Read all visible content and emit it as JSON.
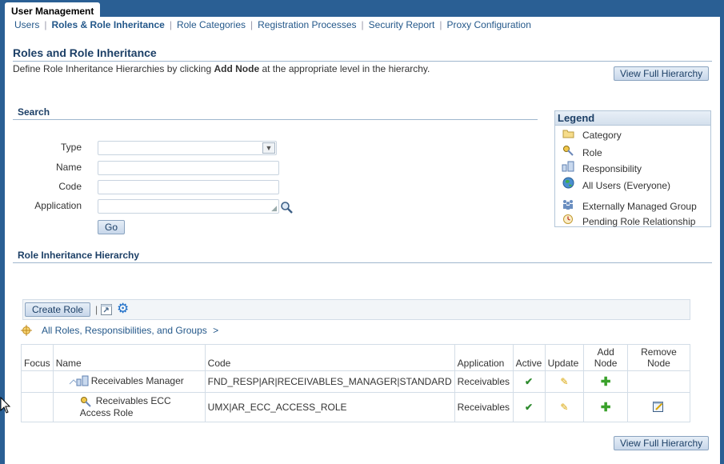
{
  "app_tab": "User Management",
  "subtabs": [
    {
      "label": "Users",
      "active": false
    },
    {
      "label": "Roles & Role Inheritance",
      "active": true
    },
    {
      "label": "Role Categories",
      "active": false
    },
    {
      "label": "Registration Processes",
      "active": false
    },
    {
      "label": "Security Report",
      "active": false
    },
    {
      "label": "Proxy Configuration",
      "active": false
    }
  ],
  "page": {
    "title": "Roles and Role Inheritance",
    "desc_prefix": "Define Role Inheritance Hierarchies by clicking ",
    "desc_bold": "Add Node",
    "desc_suffix": " at the appropriate level in the hierarchy.",
    "view_full_hierarchy": "View Full Hierarchy"
  },
  "search": {
    "heading": "Search",
    "type_label": "Type",
    "name_label": "Name",
    "code_label": "Code",
    "application_label": "Application",
    "go": "Go"
  },
  "legend": {
    "heading": "Legend",
    "items": [
      {
        "icon": "folder-icon",
        "label": "Category"
      },
      {
        "icon": "key-icon",
        "label": "Role"
      },
      {
        "icon": "responsibility-icon",
        "label": "Responsibility"
      },
      {
        "icon": "globe-icon",
        "label": "All Users (Everyone)"
      },
      {
        "icon": "group-icon",
        "label": "Externally Managed Group"
      },
      {
        "icon": "pending-icon",
        "label": "Pending Role Relationship"
      }
    ]
  },
  "hierarchy": {
    "heading": "Role Inheritance Hierarchy",
    "create_role": "Create Role",
    "separator": "|",
    "breadcrumb": "All Roles, Responsibilities, and Groups",
    "breadcrumb_arrow": ">",
    "columns": {
      "focus": "Focus",
      "name": "Name",
      "code": "Code",
      "application": "Application",
      "active": "Active",
      "update": "Update",
      "add_node_1": "Add",
      "add_node_2": "Node",
      "remove_node_1": "Remove",
      "remove_node_2": "Node"
    },
    "rows": [
      {
        "name": "Receivables Manager",
        "code": "FND_RESP|AR|RECEIVABLES_MANAGER|STANDARD",
        "application": "Receivables",
        "icon": "responsibility-icon"
      },
      {
        "name_1": "Receivables ECC",
        "name_2": "Access Role",
        "code": "UMX|AR_ECC_ACCESS_ROLE",
        "application": "Receivables",
        "icon": "key-icon"
      }
    ]
  },
  "colors": {
    "accent": "#1c3f66",
    "frame": "#2a5f94",
    "link": "#24588a"
  }
}
